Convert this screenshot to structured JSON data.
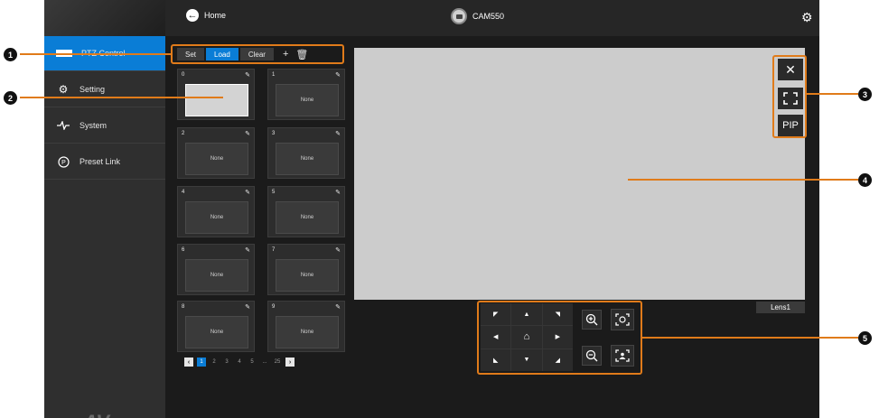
{
  "header": {
    "home_label": "Home",
    "device_name": "CAM550"
  },
  "sidebar": {
    "items": [
      {
        "label": "PTZ Control",
        "icon": "ptz-icon",
        "active": true
      },
      {
        "label": "Setting",
        "icon": "gear-icon"
      },
      {
        "label": "System",
        "icon": "pulse-icon"
      },
      {
        "label": "Preset Link",
        "icon": "preset-link-icon"
      }
    ],
    "brand": "AVer"
  },
  "preset_toolbar": {
    "set_label": "Set",
    "load_label": "Load",
    "clear_label": "Clear",
    "add_icon": "+",
    "delete_icon": "trash-icon"
  },
  "presets": [
    {
      "num": "0",
      "label": ""
    },
    {
      "num": "1",
      "label": "None"
    },
    {
      "num": "2",
      "label": "None"
    },
    {
      "num": "3",
      "label": "None"
    },
    {
      "num": "4",
      "label": "None"
    },
    {
      "num": "5",
      "label": "None"
    },
    {
      "num": "6",
      "label": "None"
    },
    {
      "num": "7",
      "label": "None"
    },
    {
      "num": "8",
      "label": "None"
    },
    {
      "num": "9",
      "label": "None"
    }
  ],
  "pagination": {
    "pages": [
      "1",
      "2",
      "3",
      "4",
      "5",
      "...",
      "25"
    ],
    "current": "1"
  },
  "video_controls": {
    "close_icon": "✕",
    "fullscreen_icon": "fullscreen-icon",
    "pip_label": "PIP"
  },
  "lens_label": "Lens1",
  "callouts": [
    "1",
    "2",
    "3",
    "4",
    "5"
  ],
  "colors": {
    "accent": "#0a7dd6",
    "callout": "#e07b1a"
  }
}
